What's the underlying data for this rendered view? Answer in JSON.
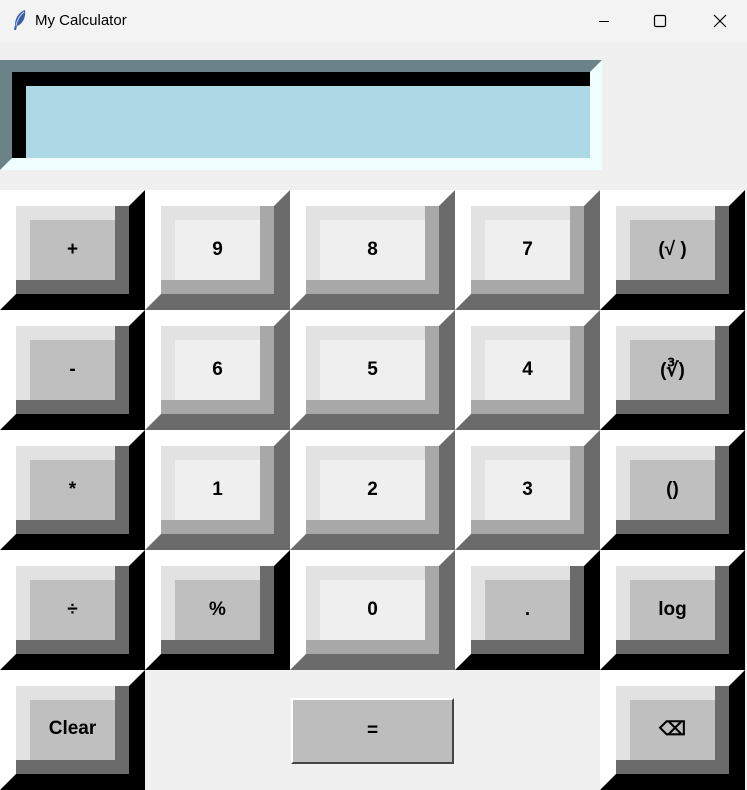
{
  "window": {
    "title": "My Calculator"
  },
  "display": {
    "value": ""
  },
  "keys": {
    "plus": "+",
    "nine": "9",
    "eight": "8",
    "seven": "7",
    "sqrt": "(√ )",
    "minus": "-",
    "six": "6",
    "five": "5",
    "four": "4",
    "cbrt": "(∛)",
    "multiply": "*",
    "one": "1",
    "two": "2",
    "three": "3",
    "parens": "()",
    "divide": "÷",
    "percent": "%",
    "zero": "0",
    "dot": ".",
    "log": "log",
    "clear": "Clear",
    "equals": "=",
    "backspace": "⌫"
  }
}
